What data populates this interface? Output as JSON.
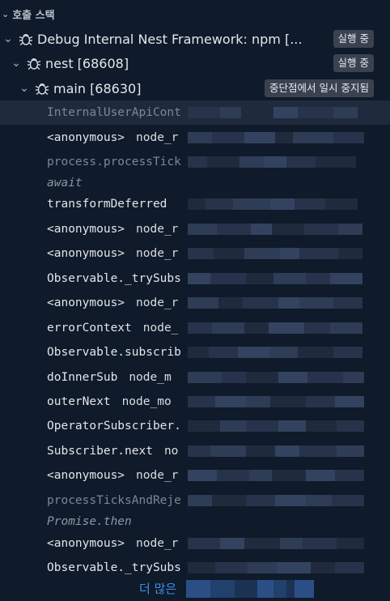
{
  "section": {
    "title": "호출 스택"
  },
  "sessions": [
    {
      "label": "Debug Internal Nest Framework: npm [...",
      "status": "실행 중"
    },
    {
      "label": "nest [68608]",
      "status": "실행 중"
    },
    {
      "label": "main [68630]",
      "status": "중단점에서 일시 중지됨"
    }
  ],
  "frames": [
    {
      "fn": "InternalUserApiCont",
      "src": ""
    },
    {
      "fn": "<anonymous>",
      "src": "node_r"
    },
    {
      "fn": "process.processTick",
      "src": ""
    },
    {
      "separator": "await"
    },
    {
      "fn": "transformDeferred",
      "src": ""
    },
    {
      "fn": "<anonymous>",
      "src": "node_r"
    },
    {
      "fn": "<anonymous>",
      "src": "node_r"
    },
    {
      "fn": "Observable._trySubs",
      "src": ""
    },
    {
      "fn": "<anonymous>",
      "src": "node_r"
    },
    {
      "fn": "errorContext",
      "src": "node_"
    },
    {
      "fn": "Observable.subscrib",
      "src": ""
    },
    {
      "fn": "doInnerSub",
      "src": "node_m"
    },
    {
      "fn": "outerNext",
      "src": "node_mo"
    },
    {
      "fn": "OperatorSubscriber.",
      "src": ""
    },
    {
      "fn": "Subscriber.next",
      "src": "no"
    },
    {
      "fn": "<anonymous>",
      "src": "node_r"
    },
    {
      "fn": "processTicksAndReje",
      "src": ""
    },
    {
      "separator": "Promise.then"
    },
    {
      "fn": "<anonymous>",
      "src": "node_r"
    },
    {
      "fn": "Observable._trySubs",
      "src": ""
    }
  ],
  "more_label": "더 많은",
  "colors": {
    "background": "#0f1a2a",
    "link": "#3e8ee8",
    "badge": "#3a4250"
  }
}
